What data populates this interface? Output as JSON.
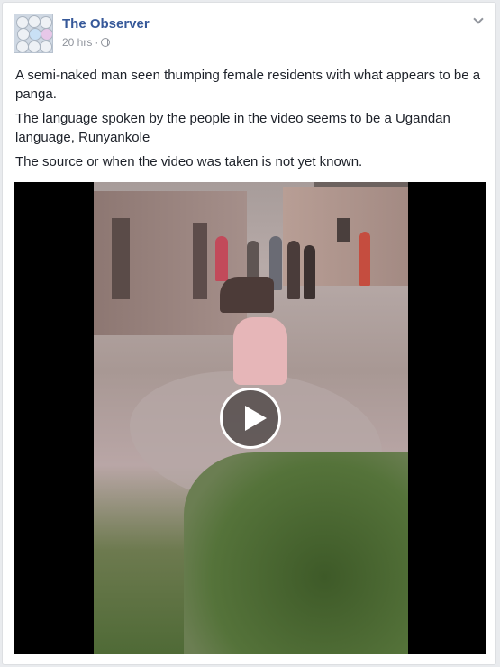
{
  "post": {
    "page_name": "The Observer",
    "time": "20 hrs",
    "separator": "·",
    "audience_icon": "globe-icon",
    "menu_icon": "chevron-down-icon",
    "paragraphs": [
      "A semi-naked man seen thumping female residents with what appears to be a panga.",
      "The language spoken by the people in the video seems to be a Ugandan language, Runyankole",
      "The source or when the video was taken is not yet known."
    ],
    "video": {
      "play_icon": "play-icon"
    }
  },
  "colors": {
    "link": "#365899",
    "meta": "#90949c",
    "text": "#1d2129",
    "background": "#e9ebee"
  }
}
